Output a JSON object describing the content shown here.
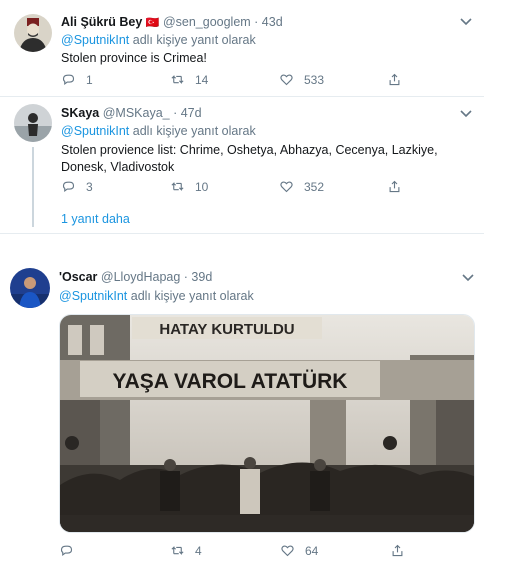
{
  "tweets": [
    {
      "name": "Ali Şükrü Bey",
      "flag": "🇹🇷",
      "handle": "@sen_googlem · 43d",
      "reply_prefix": "",
      "mention": "@SputnikInt",
      "reply_suffix": " adlı kişiye yanıt olarak",
      "text": "Stolen province is Crimea!",
      "replies": "1",
      "retweets": "14",
      "likes": "533"
    },
    {
      "name": "SKaya",
      "handle": "@MSKaya_ · 47d",
      "mention": "@SputnikInt",
      "reply_suffix": " adlı kişiye yanıt olarak",
      "text": "Stolen provience list: Chrime, Oshetya, Abhazya, Cecenya, Lazkiye, Donesk, Vladivostok",
      "replies": "3",
      "retweets": "10",
      "likes": "352",
      "more_replies": "1 yanıt daha"
    },
    {
      "name": "'Oscar",
      "handle": "@LloydHapag · 39d",
      "mention": "@SputnikInt",
      "reply_suffix": " adlı kişiye yanıt olarak",
      "photo_banner_top": "HATAY KURTULDU",
      "photo_banner_main": "YAŞA VAROL ATATÜRK",
      "replies": "",
      "retweets": "4",
      "likes": "64"
    }
  ],
  "colors": {
    "accent": "#1b95e0",
    "muted": "#657786",
    "text": "#14171a",
    "divider": "#e6ecf0"
  },
  "icons": [
    "reply-icon",
    "retweet-icon",
    "like-icon",
    "share-icon",
    "chevron-down-icon"
  ]
}
